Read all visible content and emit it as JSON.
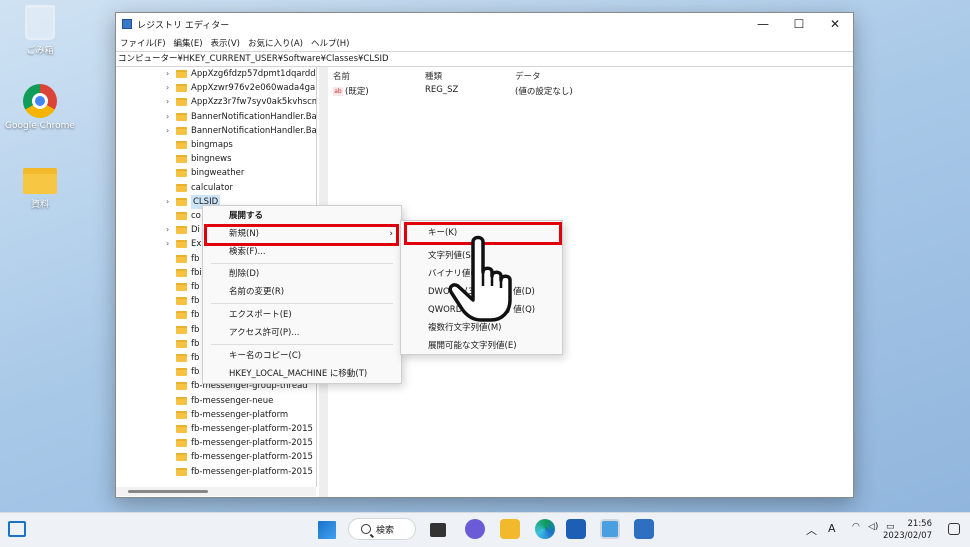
{
  "desktop": {
    "icons": [
      {
        "label": "ごみ箱",
        "icon": "recycle-bin-icon"
      },
      {
        "label": "Google Chrome",
        "icon": "chrome-icon"
      },
      {
        "label": "資料",
        "icon": "folder-icon"
      }
    ]
  },
  "window": {
    "title": "レジストリ エディター",
    "menu": [
      "ファイル(F)",
      "編集(E)",
      "表示(V)",
      "お気に入り(A)",
      "ヘルプ(H)"
    ],
    "address": "コンピューター¥HKEY_CURRENT_USER¥Software¥Classes¥CLSID",
    "tree": [
      {
        "label": "AppXzg6fdzp57dpmt1dqardd",
        "expander": true
      },
      {
        "label": "AppXzwr976v2e060wada4gal",
        "expander": true
      },
      {
        "label": "AppXzz3r7fw7syv0ak5kvhscm",
        "expander": true
      },
      {
        "label": "BannerNotificationHandler.Ban",
        "expander": true
      },
      {
        "label": "BannerNotificationHandler.Ban",
        "expander": true
      },
      {
        "label": "bingmaps",
        "expander": false
      },
      {
        "label": "bingnews",
        "expander": false
      },
      {
        "label": "bingweather",
        "expander": false
      },
      {
        "label": "calculator",
        "expander": false
      },
      {
        "label": "CLSID",
        "expander": true,
        "selected": true
      },
      {
        "label": "co",
        "expander": false
      },
      {
        "label": "Di",
        "expander": true
      },
      {
        "label": "Ex",
        "expander": true
      },
      {
        "label": "fb",
        "expander": false
      },
      {
        "label": "fbi",
        "expander": false
      },
      {
        "label": "fb",
        "expander": false
      },
      {
        "label": "fb",
        "expander": false
      },
      {
        "label": "fb",
        "expander": false
      },
      {
        "label": "fb",
        "expander": false
      },
      {
        "label": "fb",
        "expander": false
      },
      {
        "label": "fb",
        "expander": false
      },
      {
        "label": "fb",
        "expander": false
      },
      {
        "label": "fb-messenger-group-thread",
        "expander": false
      },
      {
        "label": "fb-messenger-neue",
        "expander": false
      },
      {
        "label": "fb-messenger-platform",
        "expander": false
      },
      {
        "label": "fb-messenger-platform-2015",
        "expander": false
      },
      {
        "label": "fb-messenger-platform-2015",
        "expander": false
      },
      {
        "label": "fb-messenger-platform-2015",
        "expander": false
      },
      {
        "label": "fb-messenger-platform-2015",
        "expander": false
      }
    ],
    "list": {
      "headers": {
        "name": "名前",
        "type": "種類",
        "data": "データ"
      },
      "rows": [
        {
          "name": "(既定)",
          "type": "REG_SZ",
          "data": "(値の設定なし)"
        }
      ]
    }
  },
  "context_menu": {
    "items": [
      {
        "label": "展開する",
        "bold": true
      },
      {
        "label": "新規(N)",
        "submenu": true,
        "highlighted": true
      },
      {
        "label": "検索(F)..."
      },
      {
        "label": "削除(D)"
      },
      {
        "label": "名前の変更(R)"
      },
      {
        "label": "エクスポート(E)"
      },
      {
        "label": "アクセス許可(P)..."
      },
      {
        "label": "キー名のコピー(C)"
      },
      {
        "label": "HKEY_LOCAL_MACHINE に移動(T)"
      }
    ]
  },
  "submenu": {
    "items": [
      {
        "label": "キー(K)",
        "highlighted": true
      },
      {
        "label": "文字列値(S)"
      },
      {
        "label": "バイナリ値(B)"
      },
      {
        "label": "DWORD (32 ビット) 値(D)"
      },
      {
        "label": "QWORD (64 ビット) 値(Q)"
      },
      {
        "label": "複数行文字列値(M)"
      },
      {
        "label": "展開可能な文字列値(E)"
      }
    ]
  },
  "taskbar": {
    "search_label": "検索",
    "ime_label": "A",
    "time": "21:56",
    "date": "2023/02/07"
  },
  "colors": {
    "highlight_border": "#e0000c",
    "accent": "#1a73c9"
  }
}
